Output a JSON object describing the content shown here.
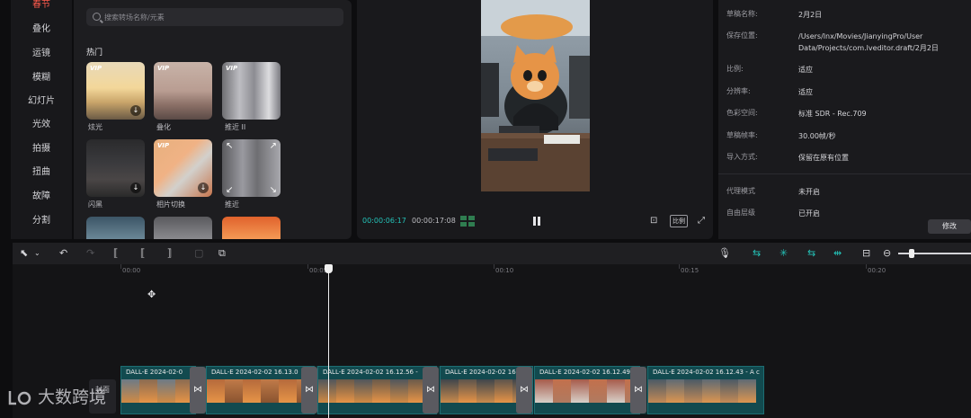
{
  "categories": [
    "春节",
    "叠化",
    "运镜",
    "模糊",
    "幻灯片",
    "光效",
    "拍摄",
    "扭曲",
    "故障",
    "分割"
  ],
  "search": {
    "placeholder": "搜索转场名称/元素"
  },
  "section_title": "热门",
  "thumbnails": [
    {
      "label": "炫光",
      "vip": "VIP",
      "download": true
    },
    {
      "label": "叠化",
      "vip": "VIP",
      "download": false
    },
    {
      "label": "推近 II",
      "vip": "VIP",
      "download": false
    },
    {
      "label": "闪黑",
      "vip": "",
      "download": true
    },
    {
      "label": "相片切换",
      "vip": "VIP",
      "download": true
    },
    {
      "label": "推近",
      "vip": "",
      "download": false
    }
  ],
  "player": {
    "current_time": "00:00:06:17",
    "total_time": "00:00:17:08",
    "ratio_label": "比例"
  },
  "info": {
    "rows": [
      {
        "key": "草稿名称:",
        "value": "2月2日"
      },
      {
        "key": "保存位置:",
        "value": "/Users/lnx/Movies/JianyingPro/User Data/Projects/com.lveditor.draft/2月2日"
      },
      {
        "key": "比例:",
        "value": "适应"
      },
      {
        "key": "分辨率:",
        "value": "适应"
      },
      {
        "key": "色彩空间:",
        "value": "标准 SDR - Rec.709"
      },
      {
        "key": "草稿帧率:",
        "value": "30.00帧/秒"
      },
      {
        "key": "导入方式:",
        "value": "保留在原有位置"
      },
      {
        "key": "代理模式",
        "value": "未开启"
      },
      {
        "key": "自由层级",
        "value": "已开启"
      }
    ],
    "modify_label": "修改"
  },
  "ruler": [
    "00:00",
    "00:05",
    "00:10",
    "00:15",
    "00:20"
  ],
  "timeline": {
    "cover_label": "封面",
    "clips": [
      {
        "label": "DALL-E 2024-02-0"
      },
      {
        "label": "DALL-E 2024-02-02 16.13.0"
      },
      {
        "label": "DALL-E 2024-02-02 16.12.56 -"
      },
      {
        "label": "DALL-E 2024-02-02 16"
      },
      {
        "label": "DALL-E 2024-02-02 16.12.49"
      },
      {
        "label": "DALL-E 2024-02-02 16.12.43 - A c"
      }
    ]
  },
  "watermark": {
    "text": "大数跨境"
  },
  "colors": {
    "accent": "#24c2b8",
    "first_category": "#ff5a4d",
    "clip": "#124a4f"
  }
}
